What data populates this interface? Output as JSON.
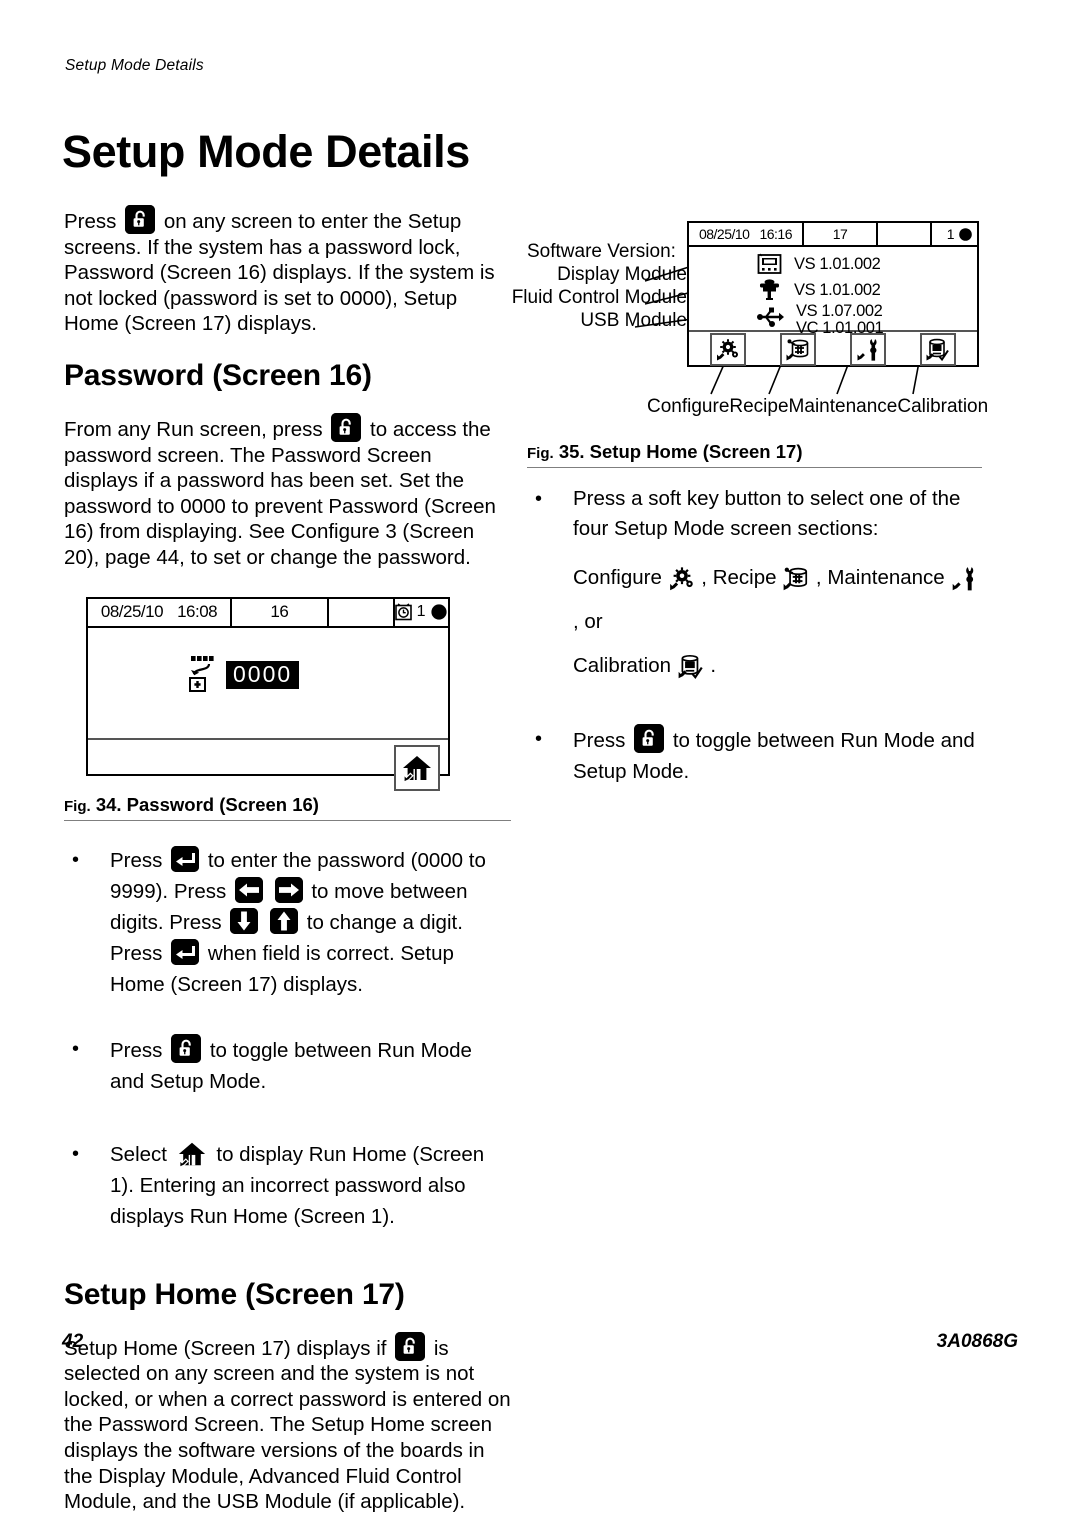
{
  "running_head": "Setup Mode Details",
  "page_title": "Setup Mode Details",
  "footer": {
    "page_number": "42",
    "document_id": "3A0868G"
  },
  "left_column": {
    "intro_p1": "Press",
    "intro_p2": "on any screen to enter the Setup screens. If the system has a password lock, Password (Screen 16) displays. If the system is not locked (password is set to 0000), Setup Home (Screen 17) displays.",
    "password_heading": "Password (Screen 16)",
    "password_p1": "From any Run screen, press",
    "password_p2": "to access the password screen. The Password Screen displays if a password has been set. Set the password to 0000 to prevent Password (Screen 16) from displaying. See Configure 3 (Screen 20), page 44, to set or change the password.",
    "fig34": {
      "caption_prefix": "Fig.",
      "caption": "34. Password (Screen 16)",
      "screen": {
        "date": "08/25/10",
        "time": "16:08",
        "screen_number": "16",
        "blank_cell": "",
        "alarm_count": "1",
        "password_value": "0000",
        "softkey_home": "home-icon"
      }
    },
    "bullets": [
      {
        "seg1": "Press",
        "icon1": "enter-key-icon",
        "seg2": "to enter the password (0000 to 9999). Press",
        "icon2": "left-arrow-key-icon",
        "icon3": "right-arrow-key-icon",
        "seg3": "to move between digits. Press",
        "icon4": "down-arrow-key-icon",
        "icon5": "up-arrow-key-icon",
        "seg4": "to change a digit. Press",
        "icon6": "enter-key-icon",
        "seg5": "when field is correct. Setup Home (Screen 17) displays."
      },
      {
        "seg1": "Press",
        "icon1": "lock-key-icon",
        "seg2": "to toggle between Run Mode and Setup Mode."
      },
      {
        "seg1": "Select",
        "icon1": "home-icon",
        "seg2": "to display Run Home (Screen 1). Entering an incorrect password also displays Run Home (Screen 1)."
      }
    ],
    "setup_home_heading": "Setup Home (Screen 17)",
    "setup_home_p1": "Setup Home (Screen 17) displays if",
    "setup_home_p2": "is selected on any screen and the system is not locked, or when a correct password is entered on the Password Screen. The Setup Home screen displays the software versions of the boards in the Display Module, Advanced Fluid Control Module, and the USB Module (if applicable)."
  },
  "right_column": {
    "fig35": {
      "callouts": {
        "title": "Software Version:",
        "display_module": "Display Module",
        "fluid_control_module": "Fluid Control Module",
        "usb_module": "USB Module"
      },
      "screen": {
        "date": "08/25/10",
        "time": "16:16",
        "screen_number": "17",
        "blank_cell": "",
        "alarm_count": "1",
        "rows": [
          {
            "icon": "display-module-icon",
            "versions": [
              "VS 1.01.002"
            ]
          },
          {
            "icon": "fluid-control-module-icon",
            "versions": [
              "VS 1.01.002"
            ]
          },
          {
            "icon": "usb-module-icon",
            "versions": [
              "VS 1.07.002",
              "VC 1.01.001"
            ]
          }
        ],
        "softkeys": [
          {
            "icon": "configure-gear-icon",
            "label": "Configure"
          },
          {
            "icon": "recipe-icon",
            "label": "Recipe"
          },
          {
            "icon": "maintenance-wrench-icon",
            "label": "Maintenance"
          },
          {
            "icon": "calibration-icon",
            "label": "Calibration"
          }
        ]
      },
      "caption_prefix": "Fig.",
      "caption": "35. Setup Home (Screen 17)"
    },
    "bullets": [
      {
        "seg1": "Press a soft key button to select one of the four Setup Mode screen sections:",
        "line2_a": "Configure",
        "line2_b": ", Recipe",
        "line2_c": ", Maintenance",
        "line2_d": ", or",
        "line3_a": "Calibration",
        "line3_b": "."
      },
      {
        "seg1": "Press",
        "icon1": "lock-key-icon",
        "seg2": "to toggle between Run Mode and Setup Mode."
      }
    ]
  }
}
